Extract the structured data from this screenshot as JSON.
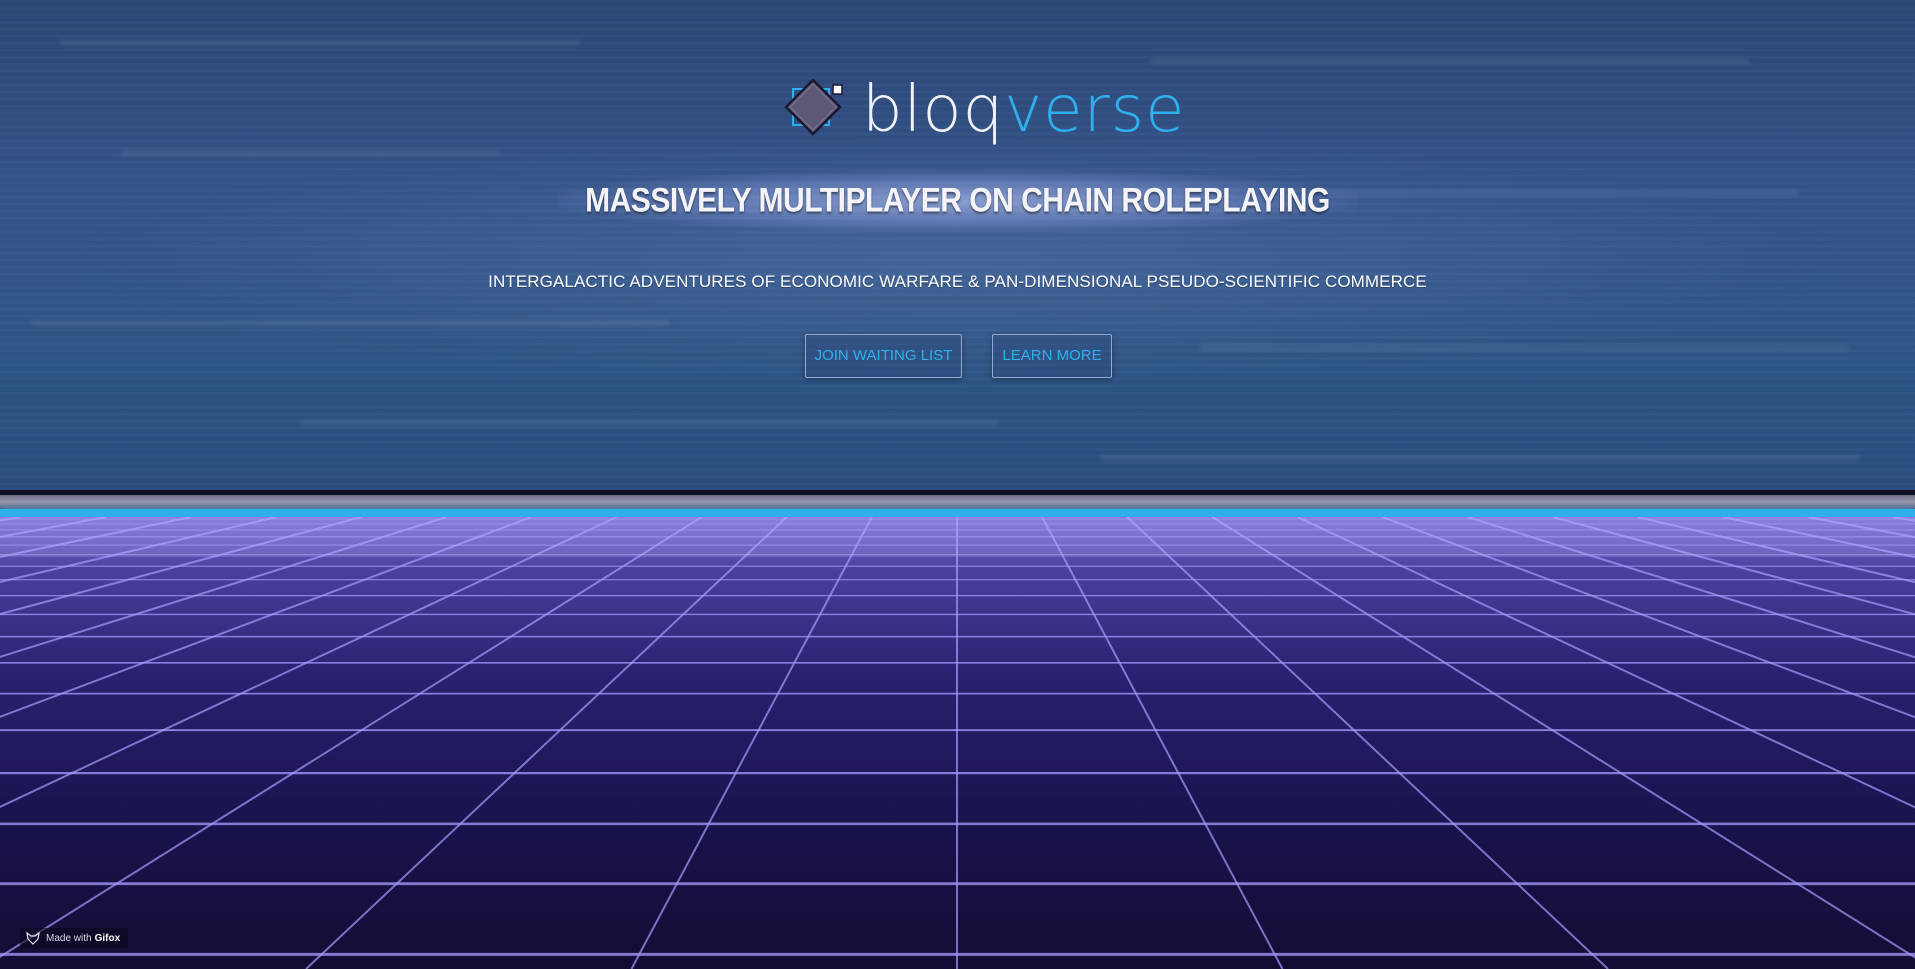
{
  "brand": {
    "name_part1": "bloq",
    "name_part2": "verse",
    "logo_icon": "diamond-cube-icon",
    "accent_color": "#2fb0ec"
  },
  "hero": {
    "tagline": "MASSIVELY MULTIPLAYER ON CHAIN ROLEPLAYING",
    "subtitle": "INTERGALACTIC ADVENTURES OF ECONOMIC WARFARE & PAN-DIMENSIONAL PSEUDO-SCIENTIFIC COMMERCE"
  },
  "actions": {
    "join_label": "JOIN WAITING LIST",
    "learn_label": "LEARN MORE"
  },
  "watermark": {
    "prefix": "Made with",
    "brand": "Gifox",
    "icon": "fox-icon"
  }
}
